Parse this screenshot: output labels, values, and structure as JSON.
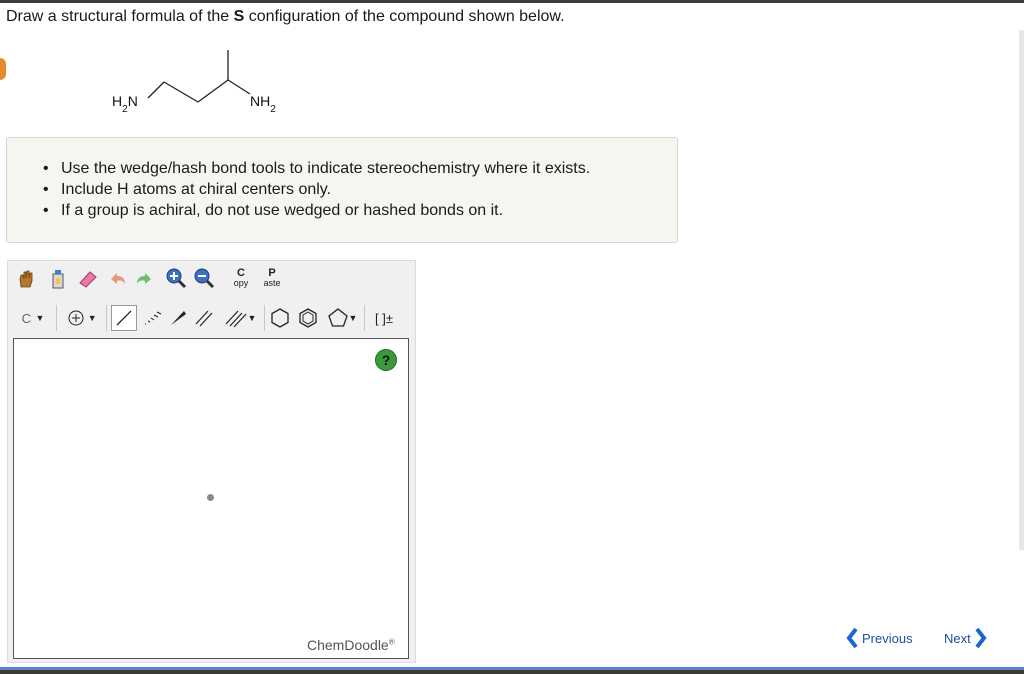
{
  "question": {
    "prefix": "Draw a structural formula of the ",
    "config": "S",
    "suffix": " configuration of the compound shown below."
  },
  "molecule": {
    "left_label": "H2N",
    "right_label": "NH2"
  },
  "instructions": [
    "Use the wedge/hash bond tools to indicate stereochemistry where it exists.",
    "Include H atoms at chiral centers only.",
    "If a group is achiral, do not use wedged or hashed bonds on it."
  ],
  "toolbar": {
    "copy_top": "C",
    "copy_bottom": "opy",
    "paste_top": "P",
    "paste_bottom": "aste",
    "element": "C",
    "bracket": "[ ]±"
  },
  "editor": {
    "help": "?",
    "brand": "ChemDoodle",
    "brand_mark": "®"
  },
  "nav": {
    "previous": "Previous",
    "next": "Next"
  }
}
